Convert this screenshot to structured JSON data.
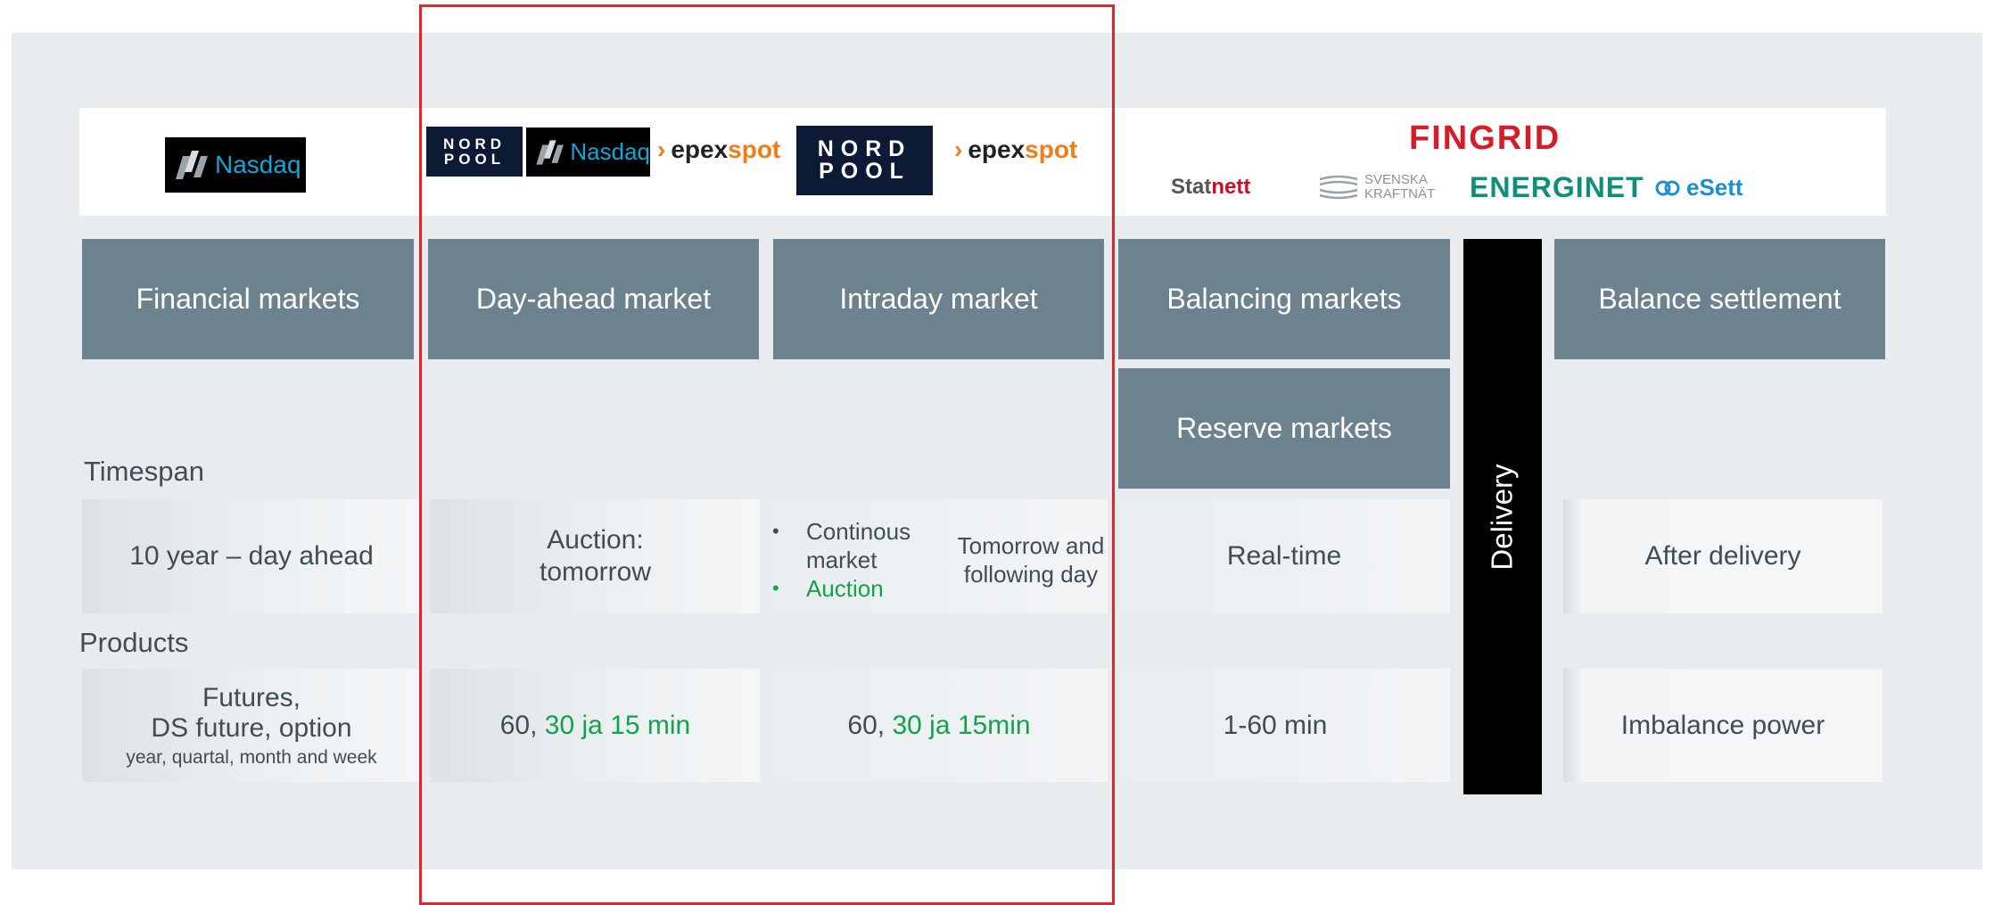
{
  "logos": {
    "nasdaq": "Nasdaq",
    "nordpool_line1": "NORD",
    "nordpool_line2": "POOL",
    "epex_a": "epex",
    "epex_b": "spot",
    "fingrid": "FINGRID",
    "statnett_a": "Stat",
    "statnett_b": "nett",
    "svk_line1": "SVENSKA",
    "svk_line2": "KRAFTNÄT",
    "energinet": "ENERGINET",
    "esett": "eSett"
  },
  "headers": {
    "financial": "Financial markets",
    "dayahead": "Day-ahead market",
    "intraday": "Intraday market",
    "balancing": "Balancing markets",
    "settlement": "Balance settlement",
    "reserve": "Reserve markets",
    "delivery": "Delivery"
  },
  "labels": {
    "timespan": "Timespan",
    "products": "Products"
  },
  "timespan": {
    "financial": "10 year – day ahead",
    "dayahead_line1": "Auction:",
    "dayahead_line2": "tomorrow",
    "intraday_bullet1_line1": "Continous",
    "intraday_bullet1_line2": "market",
    "intraday_bullet2": "Auction",
    "intraday_right_line1": "Tomorrow and",
    "intraday_right_line2": "following day",
    "balancing": "Real-time",
    "settlement": "After delivery"
  },
  "products": {
    "financial_line1": "Futures,",
    "financial_line2": "DS future, option",
    "financial_line3": "year, quartal, month and week",
    "dayahead_prefix": "60, ",
    "dayahead_green": "30 ja 15 min",
    "intraday_prefix": "60, ",
    "intraday_green": "30 ja 15min",
    "balancing": "1-60 min",
    "settlement": "Imbalance power"
  },
  "colors": {
    "header_bg": "#6d828f",
    "panel_bg": "#e9ecef",
    "highlight_frame": "#e3242b",
    "accent_green": "#12a34a"
  }
}
